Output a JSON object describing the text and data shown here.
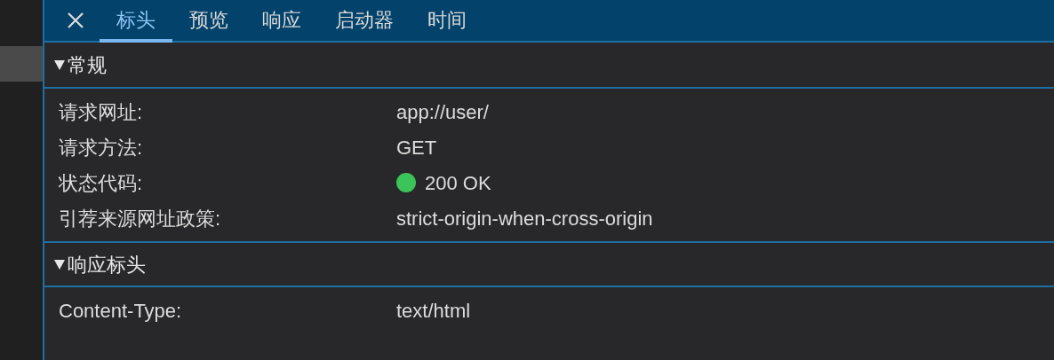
{
  "tabs": [
    {
      "label": "标头",
      "selected": true
    },
    {
      "label": "预览",
      "selected": false
    },
    {
      "label": "响应",
      "selected": false
    },
    {
      "label": "启动器",
      "selected": false
    },
    {
      "label": "时间",
      "selected": false
    }
  ],
  "sections": [
    {
      "title": "常规",
      "expanded": true,
      "rows": [
        {
          "kind": "text",
          "name": "请求网址:",
          "value": "app://user/"
        },
        {
          "kind": "text",
          "name": "请求方法:",
          "value": "GET"
        },
        {
          "kind": "status",
          "name": "状态代码:",
          "value": "200 OK",
          "color": "#3bc45a"
        },
        {
          "kind": "text",
          "name": "引荐来源网址政策:",
          "value": "strict-origin-when-cross-origin"
        }
      ]
    },
    {
      "title": "响应标头",
      "expanded": true,
      "rows": [
        {
          "kind": "text",
          "name": "Content-Type:",
          "value": "text/html"
        }
      ]
    }
  ]
}
